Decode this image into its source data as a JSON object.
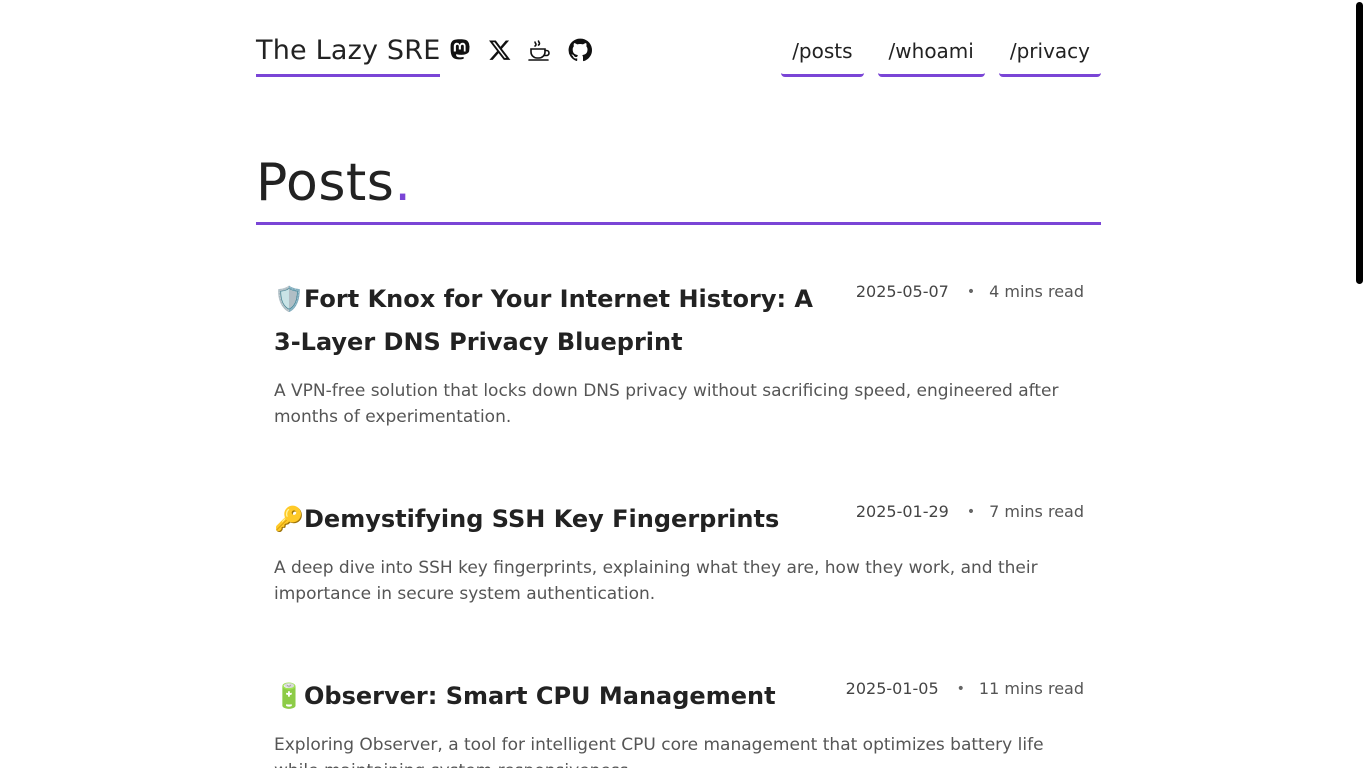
{
  "header": {
    "brand": "The Lazy SRE",
    "socials": [
      {
        "name": "mastodon-icon"
      },
      {
        "name": "x-icon"
      },
      {
        "name": "coffee-icon"
      },
      {
        "name": "github-icon"
      }
    ],
    "nav": [
      {
        "label": "/posts"
      },
      {
        "label": "/whoami"
      },
      {
        "label": "/privacy"
      }
    ]
  },
  "main": {
    "heading": "Posts",
    "heading_dot": "."
  },
  "posts": [
    {
      "emoji": "🛡️",
      "title": "Fort Knox for Your Internet History: A 3-Layer DNS Privacy Blueprint",
      "date": "2025-05-07",
      "read_time": "4 mins read",
      "description": "A VPN-free solution that locks down DNS privacy without sacrificing speed, engineered after months of experimentation."
    },
    {
      "emoji": "🔑",
      "title": "Demystifying SSH Key Fingerprints",
      "date": "2025-01-29",
      "read_time": "7 mins read",
      "description": "A deep dive into SSH key fingerprints, explaining what they are, how they work, and their importance in secure system authentication."
    },
    {
      "emoji": "🔋",
      "title": "Observer: Smart CPU Management",
      "date": "2025-01-05",
      "read_time": "11 mins read",
      "description": "Exploring Observer, a tool for intelligent CPU core management that optimizes battery life while maintaining system responsiveness."
    }
  ],
  "colors": {
    "accent": "#7a45d6",
    "text": "#222222",
    "muted": "#555555"
  }
}
